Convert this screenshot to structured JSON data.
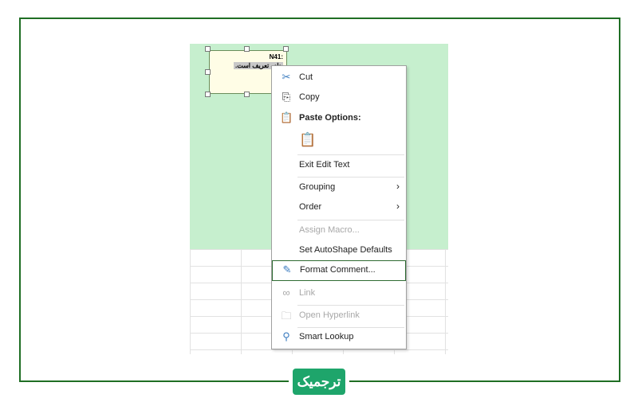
{
  "comment": {
    "author": "N41:",
    "text": "داده تعریف است."
  },
  "menu": {
    "items": [
      {
        "label": "Cut",
        "icon": "scissors-icon",
        "enabled": true
      },
      {
        "label": "Copy",
        "icon": "copy-icon",
        "enabled": true
      },
      {
        "label": "Paste Options:",
        "icon": "paste-icon",
        "enabled": true
      },
      {
        "label": "Exit Edit Text",
        "enabled": true
      },
      {
        "label": "Grouping",
        "submenu": true,
        "enabled": true
      },
      {
        "label": "Order",
        "submenu": true,
        "enabled": true
      },
      {
        "label": "Assign Macro...",
        "enabled": false
      },
      {
        "label": "Set AutoShape Defaults",
        "enabled": true
      },
      {
        "label": "Format Comment...",
        "icon": "format-brush-icon",
        "enabled": true,
        "highlighted": true
      },
      {
        "label": "Link",
        "icon": "link-icon",
        "enabled": false
      },
      {
        "label": "Open Hyperlink",
        "icon": "open-hyperlink-icon",
        "enabled": false
      },
      {
        "label": "Smart Lookup",
        "icon": "search-icon",
        "enabled": true
      }
    ],
    "submenu_arrow": "›"
  },
  "logo": {
    "text": "ترجمیک"
  },
  "colors": {
    "frame": "#1f6e24",
    "sheet_highlight": "#c6efce",
    "logo": "#1ea56b"
  }
}
